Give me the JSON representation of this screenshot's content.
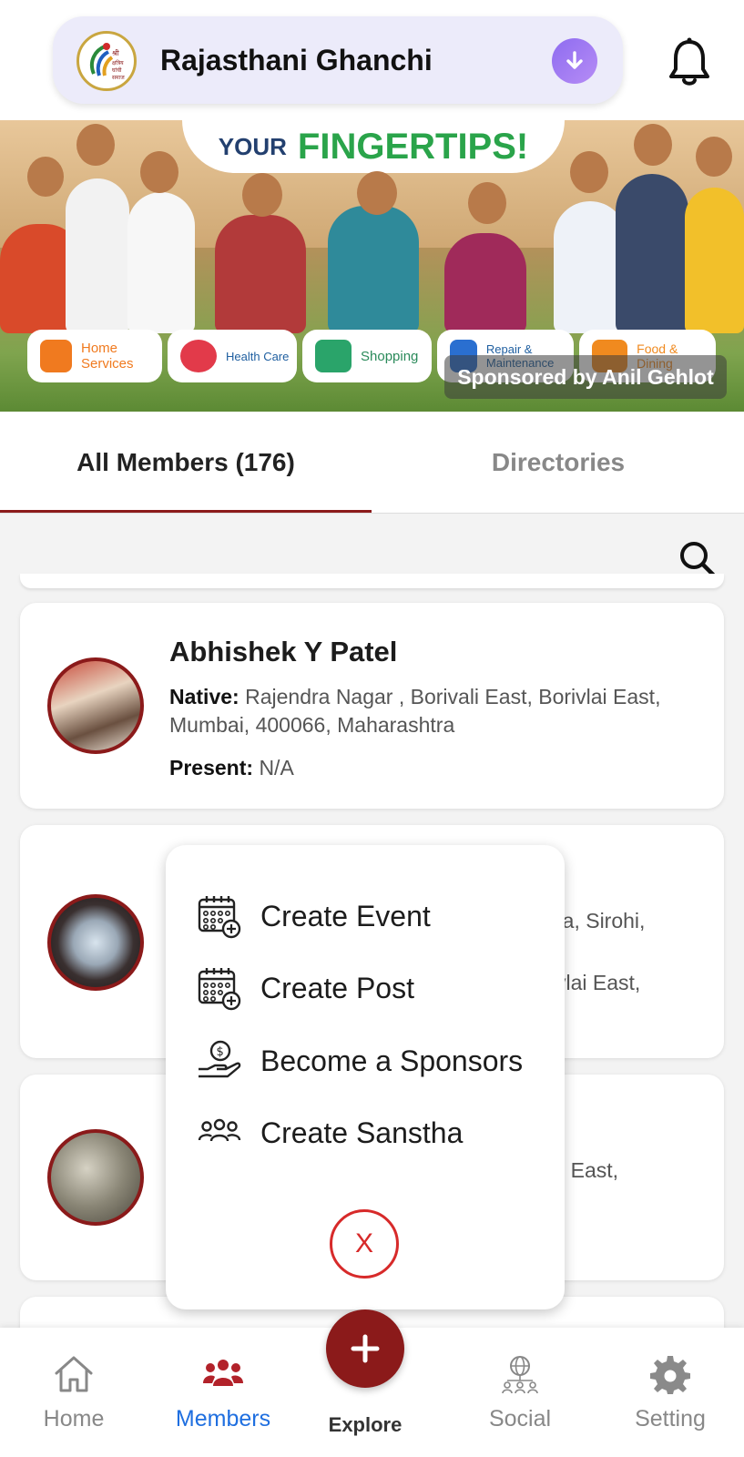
{
  "header": {
    "app_title": "Rajasthani Ghanchi",
    "logo_text": "श्री क्षत्रिय घांची समाज"
  },
  "banner": {
    "headline_a": "YOUR",
    "headline_b": "FINGERTIPS!",
    "categories": [
      {
        "label": "Home Services",
        "color": "#f07a1f"
      },
      {
        "label": "Health Care",
        "color": "#e23a4a"
      },
      {
        "label": "Shopping",
        "color": "#2aa46a"
      },
      {
        "label": "Repair & Maintenance",
        "color": "#2a6fd0"
      },
      {
        "label": "Food & Dining",
        "color": "#f08a1f"
      }
    ],
    "sponsor_text": "Sponsored by Anil Gehlot"
  },
  "tabs": {
    "all_members": "All Members (176)",
    "directories": "Directories"
  },
  "members": [
    {
      "name": "Abhishek Y Patel",
      "native_label": "Native:",
      "native_value": "Rajendra Nagar , Borivali East, Borivlai East, Mumbai, 400066, Maharashtra",
      "present_label": "Present:",
      "present_value": "N/A"
    },
    {
      "fragment_1": "ra, Sirohi,",
      "fragment_2": "vlai East,"
    },
    {
      "fragment_1": "li East,"
    }
  ],
  "menu": {
    "items": [
      {
        "label": "Create Event",
        "icon": "calendar-add-icon"
      },
      {
        "label": "Create Post",
        "icon": "calendar-add-icon"
      },
      {
        "label": "Become a Sponsors",
        "icon": "hand-coin-icon"
      },
      {
        "label": "Create Sanstha",
        "icon": "group-icon"
      }
    ],
    "close_label": "X"
  },
  "bottom_nav": {
    "home": "Home",
    "members": "Members",
    "explore": "Explore",
    "social": "Social",
    "setting": "Setting"
  },
  "colors": {
    "accent": "#8b1a1a",
    "active_nav": "#1f6fe0",
    "close_red": "#d72a2a"
  }
}
